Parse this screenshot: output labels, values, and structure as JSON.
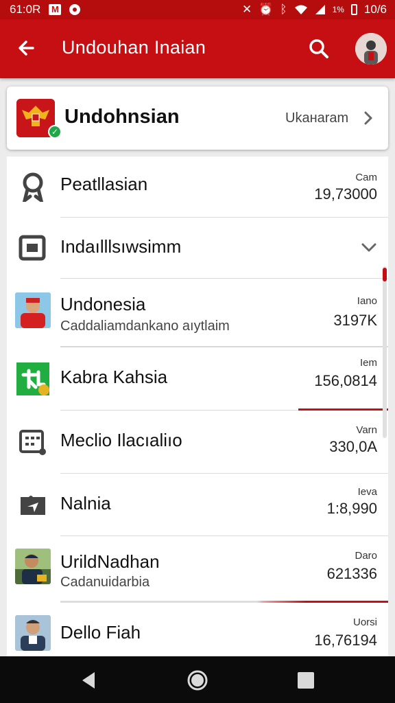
{
  "status_bar": {
    "time": "61:0R",
    "right_text": "10/6",
    "battery_text": "1%"
  },
  "app_bar": {
    "title": "Undouhan Inaian"
  },
  "header_card": {
    "name": "Undohnsian",
    "action": "Ukaнaram"
  },
  "list": {
    "rows": [
      {
        "label": "Peatllasian",
        "small": "Cam",
        "value": "19,73000",
        "icon": "award-icon"
      },
      {
        "label": "Indaılllsıwsimm",
        "icon": "tablet-icon"
      },
      {
        "label": "Undonesia",
        "sub": "Caddaliamdankano aıytlaim",
        "small": "Iano",
        "value": "3197K",
        "icon": "person-photo"
      },
      {
        "label": "Kabra Kahsia",
        "small": "Iem",
        "value": "156,0814",
        "icon": "green-app-icon"
      },
      {
        "label": "Meclio Ilacıaliıo",
        "small": "Varn",
        "value": "330,0A",
        "icon": "calculator-icon"
      },
      {
        "label": "Nalnia",
        "small": "Ieva",
        "value": "1:8,990",
        "icon": "ticket-icon"
      },
      {
        "label": "UrildNadhan",
        "sub": "Cadanuidarbia",
        "small": "Daro",
        "value": "621336",
        "icon": "person-photo"
      },
      {
        "label": "Dello Fiah",
        "small": "Uorsi",
        "value": "16,76194",
        "icon": "person-photo"
      }
    ]
  },
  "colors": {
    "primary": "#c50f12",
    "status": "#b50d0d",
    "accent_green": "#1ea84a"
  }
}
